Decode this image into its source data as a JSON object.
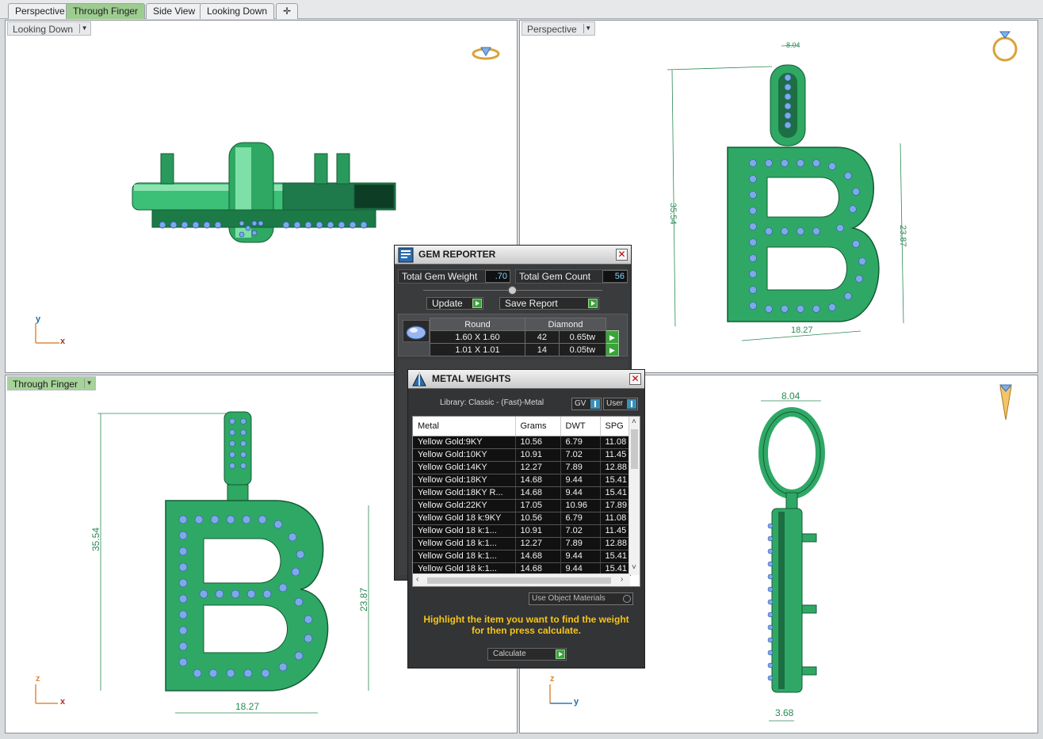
{
  "tabs": [
    {
      "label": "Perspective",
      "active": false
    },
    {
      "label": "Through Finger",
      "active": true
    },
    {
      "label": "Side View",
      "active": false
    },
    {
      "label": "Looking Down",
      "active": false
    }
  ],
  "viewports": {
    "top_left": {
      "label": "Looking Down",
      "axis": {
        "v": "y",
        "h": "x"
      }
    },
    "top_right": {
      "label": "Perspective",
      "dims": {
        "height": "35.54",
        "letter_height": "23.87",
        "width": "18.27",
        "bail": "8.04"
      }
    },
    "bottom_left": {
      "label": "Through Finger",
      "axis": {
        "v": "z",
        "h": "x"
      },
      "dims": {
        "height": "35.54",
        "letter_height": "23.87",
        "width": "18.27"
      }
    },
    "bottom_right": {
      "label": "",
      "axis": {
        "v": "z",
        "h": "y"
      },
      "dims": {
        "bail": "8.04",
        "thickness": "3.68"
      }
    }
  },
  "gem_reporter": {
    "title": "GEM REPORTER",
    "total_weight_label": "Total Gem Weight",
    "total_weight_value": ".70",
    "total_count_label": "Total Gem Count",
    "total_count_value": "56",
    "update_label": "Update",
    "save_report_label": "Save Report",
    "table_header": {
      "shape": "Round",
      "type": "Diamond"
    },
    "rows": [
      {
        "size": "1.60 X 1.60",
        "count": "42",
        "weight": "0.65tw"
      },
      {
        "size": "1.01 X 1.01",
        "count": "14",
        "weight": "0.05tw"
      }
    ]
  },
  "metal_weights": {
    "title": "METAL WEIGHTS",
    "library": "Library: Classic - (Fast)-Metal",
    "gv_label": "GV",
    "user_label": "User",
    "columns": [
      "Metal",
      "Grams",
      "DWT",
      "SPG"
    ],
    "rows": [
      [
        "Yellow Gold:9KY",
        "10.56",
        "6.79",
        "11.08"
      ],
      [
        "Yellow Gold:10KY",
        "10.91",
        "7.02",
        "11.45"
      ],
      [
        "Yellow Gold:14KY",
        "12.27",
        "7.89",
        "12.88"
      ],
      [
        "Yellow Gold:18KY",
        "14.68",
        "9.44",
        "15.41"
      ],
      [
        "Yellow Gold:18KY R...",
        "14.68",
        "9.44",
        "15.41"
      ],
      [
        "Yellow Gold:22KY",
        "17.05",
        "10.96",
        "17.89"
      ],
      [
        "Yellow Gold 18 k:9KY",
        "10.56",
        "6.79",
        "11.08"
      ],
      [
        "Yellow Gold 18 k:1...",
        "10.91",
        "7.02",
        "11.45"
      ],
      [
        "Yellow Gold 18 k:1...",
        "12.27",
        "7.89",
        "12.88"
      ],
      [
        "Yellow Gold 18 k:1...",
        "14.68",
        "9.44",
        "15.41"
      ],
      [
        "Yellow Gold 18 k:1...",
        "14.68",
        "9.44",
        "15.41"
      ]
    ],
    "use_object_materials": "Use Object Materials",
    "hint": "Highlight the item you want to find the weight for then press calculate.",
    "calculate_label": "Calculate"
  },
  "colors": {
    "active_tab": "#9ccc8f",
    "metal": "#2fa866",
    "gem": "#7fa8ea",
    "dimension": "#2b8a55",
    "hint": "#f5c518"
  }
}
